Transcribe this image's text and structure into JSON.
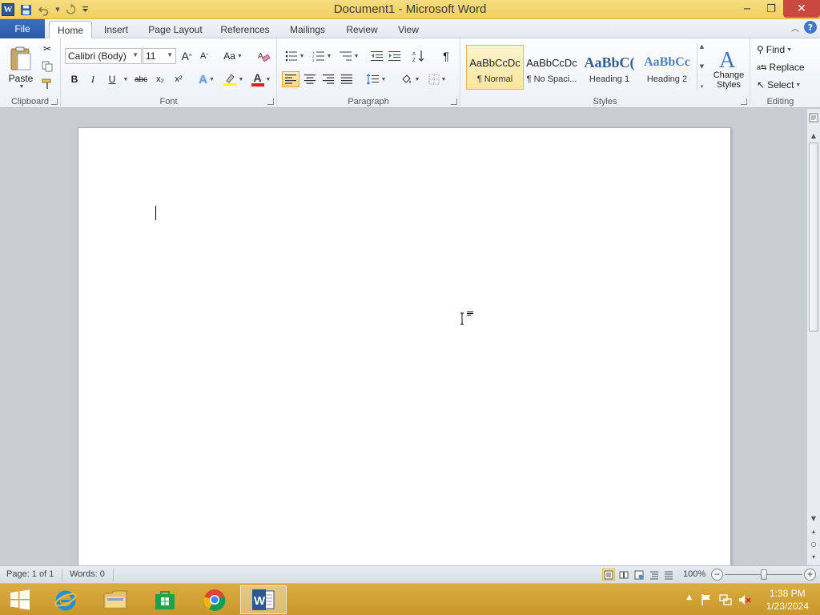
{
  "window": {
    "title": "Document1  -  Microsoft Word",
    "minimize": "−",
    "maximize": "❐",
    "close": "✕"
  },
  "tabs": {
    "file": "File",
    "home": "Home",
    "insert": "Insert",
    "page_layout": "Page Layout",
    "references": "References",
    "mailings": "Mailings",
    "review": "Review",
    "view": "View"
  },
  "clipboard": {
    "label": "Clipboard",
    "paste": "Paste"
  },
  "font": {
    "label": "Font",
    "name": "Calibri (Body)",
    "size": "11",
    "bold": "B",
    "italic": "I",
    "underline": "U",
    "strikethrough": "abc",
    "subscript": "x₂",
    "superscript": "x²",
    "grow": "A",
    "shrink": "A",
    "change_case": "Aa",
    "font_color_letter": "A",
    "highlight_color": "#ffff00",
    "font_color": "#e02020"
  },
  "paragraph": {
    "label": "Paragraph",
    "show_marks": "¶"
  },
  "styles": {
    "label": "Styles",
    "items": [
      {
        "sample": "AaBbCcDc",
        "name": "¶ Normal"
      },
      {
        "sample": "AaBbCcDc",
        "name": "¶ No Spaci..."
      },
      {
        "sample": "AaBbC(",
        "name": "Heading 1"
      },
      {
        "sample": "AaBbCc",
        "name": "Heading 2"
      }
    ],
    "change_styles": "Change Styles"
  },
  "editing": {
    "label": "Editing",
    "find": "Find",
    "replace": "Replace",
    "select": "Select"
  },
  "status": {
    "page": "Page: 1 of 1",
    "words": "Words: 0",
    "zoom": "100%",
    "zoom_minus": "−",
    "zoom_plus": "+"
  },
  "taskbar": {
    "time": "1:38 PM",
    "date": "1/23/2024"
  }
}
